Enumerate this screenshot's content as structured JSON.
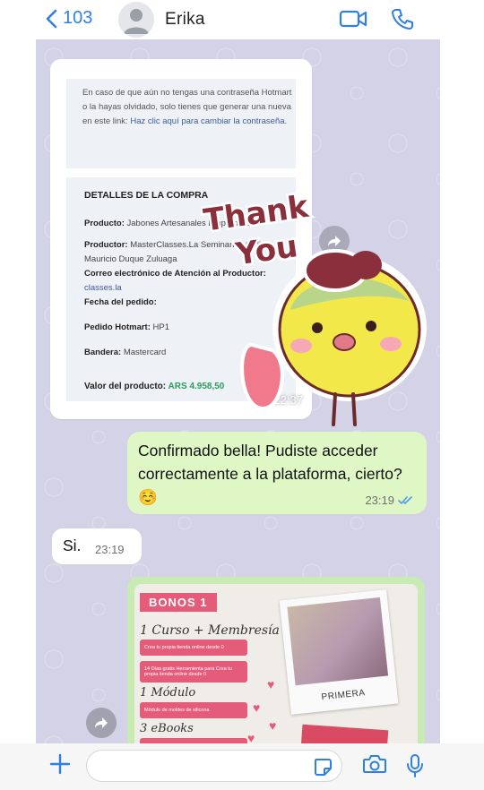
{
  "header": {
    "back_count": "103",
    "contact_name": "Erika"
  },
  "screenshot_message": {
    "notice_text": "En caso de que aún no tengas una contraseña Hotmart o la hayas olvidado, solo tienes que generar una nueva en este link: ",
    "notice_link": "Haz clic aquí para cambiar la contraseña.",
    "details_title": "DETALLES DE LA COMPRA",
    "rows": [
      {
        "label": "Producto:",
        "value": "Jabones Artesanales Emprender"
      },
      {
        "label": "Productor:",
        "value": "MasterClasses.La Seminarios.Online Mauricio Duque Zuluaga"
      },
      {
        "label": "Correo electrónico de Atención al Productor:",
        "value": "classes.la"
      },
      {
        "label": "Fecha del pedido:",
        "value": ""
      },
      {
        "label": "Pedido Hotmart:",
        "value": "HP1"
      },
      {
        "label": "Bandera:",
        "value": "Mastercard"
      }
    ],
    "value_label": "Valor del producto:",
    "value_amount": "ARS 4.958,50",
    "time": "22:37"
  },
  "sticker": {
    "line1": "Thank",
    "line2": "You"
  },
  "outgoing_message": {
    "text": "Confirmado bella! Pudiste acceder correctamente a la plataforma, cierto? ☺️",
    "time": "23:19"
  },
  "incoming_message": {
    "text": "Si.",
    "time": "23:19"
  },
  "promo_image": {
    "bonos": "BONOS 1",
    "curso": "1 Curso + Membresía",
    "pill1": "Crea tu propia tienda online desde 0",
    "pill2": "14 Días gratis Herramienta para Crea tu propia tienda online desde 0",
    "modulo": "1 Módulo",
    "pill3": "Módulo de moldes de silicona",
    "ebooks": "3 eBooks",
    "photo_caption": "PRIMERA"
  },
  "colors": {
    "accent": "#2f80e2",
    "chat_bg": "#d4d2e6",
    "outgoing_bubble": "#dff7c5",
    "pink": "#e55c7a"
  }
}
